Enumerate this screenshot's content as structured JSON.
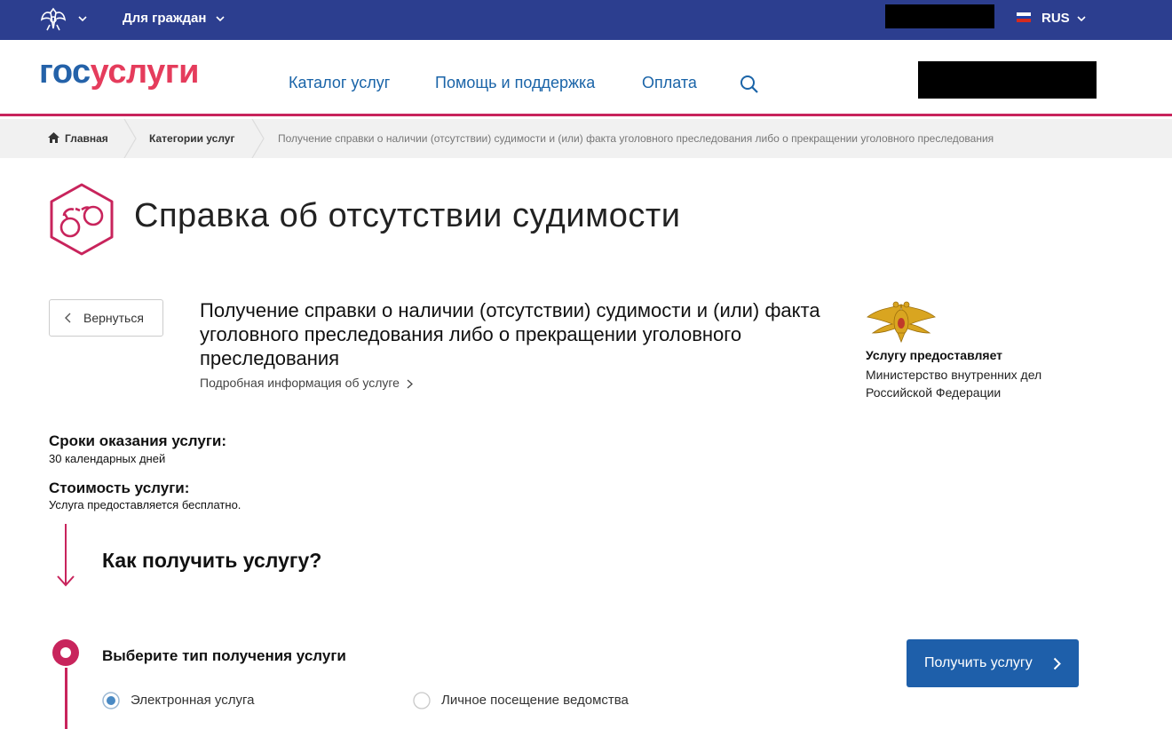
{
  "topbar": {
    "audience": "Для граждан",
    "language": "RUS",
    "colors": {
      "background": "#2c3e8f"
    }
  },
  "header": {
    "logo_part1": "гос",
    "logo_part2": "услуги",
    "nav": [
      "Каталог услуг",
      "Помощь и поддержка",
      "Оплата"
    ],
    "colors": {
      "accent_line": "#c8245c",
      "link": "#1a64a8"
    }
  },
  "breadcrumb": [
    "Главная",
    "Категории услуг",
    "Получение справки о наличии (отсутствии) судимости и (или) факта уголовного преследования либо о прекращении уголовного преследования"
  ],
  "page": {
    "title": "Справка об отсутствии судимости",
    "icon": "handcuffs-icon"
  },
  "service": {
    "back_label": "Вернуться",
    "title": "Получение справки о наличии (отсутствии) судимости и (или) факта уголовного преследования либо о прекращении уголовного преследования",
    "more_info": "Подробная информация об услуге"
  },
  "provider": {
    "label": "Услугу предоставляет",
    "name": "Министерство внутренних дел Российской Федерации"
  },
  "terms": {
    "duration_label": "Сроки оказания услуги:",
    "duration_value": "30 календарных дней",
    "cost_label": "Стоимость услуги:",
    "cost_value": "Услуга предоставляется бесплатно."
  },
  "how_to": {
    "heading": "Как получить услугу?",
    "step1_heading": "Выберите тип получения услуги",
    "options": [
      {
        "label": "Электронная услуга",
        "selected": true
      },
      {
        "label": "Личное посещение ведомства",
        "selected": false
      }
    ],
    "cta": "Получить услугу",
    "colors": {
      "cta_background": "#1e5faa",
      "step_accent": "#c8245c"
    }
  }
}
